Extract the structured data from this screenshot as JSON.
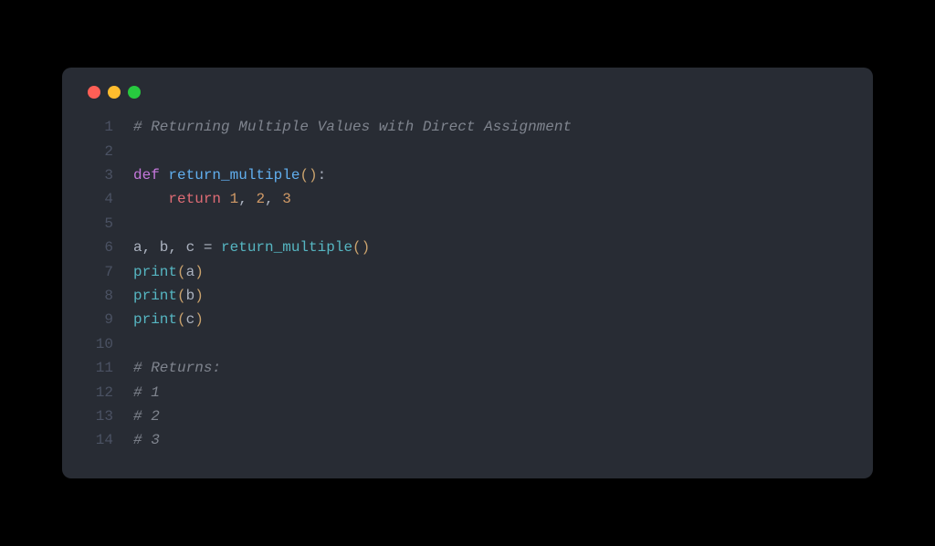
{
  "window": {
    "traffic_lights": [
      "red",
      "yellow",
      "green"
    ]
  },
  "code": {
    "lines": [
      {
        "n": "1",
        "tokens": [
          {
            "cls": "tok-comment",
            "t": "# Returning Multiple Values with Direct Assignment"
          }
        ]
      },
      {
        "n": "2",
        "tokens": []
      },
      {
        "n": "3",
        "tokens": [
          {
            "cls": "tok-def",
            "t": "def "
          },
          {
            "cls": "tok-funcname",
            "t": "return_multiple"
          },
          {
            "cls": "tok-paren",
            "t": "()"
          },
          {
            "cls": "tok-punct",
            "t": ":"
          }
        ]
      },
      {
        "n": "4",
        "tokens": [
          {
            "cls": "tok-ident",
            "t": "    "
          },
          {
            "cls": "tok-return",
            "t": "return "
          },
          {
            "cls": "tok-number",
            "t": "1"
          },
          {
            "cls": "tok-punct",
            "t": ", "
          },
          {
            "cls": "tok-number",
            "t": "2"
          },
          {
            "cls": "tok-punct",
            "t": ", "
          },
          {
            "cls": "tok-number",
            "t": "3"
          }
        ]
      },
      {
        "n": "5",
        "tokens": []
      },
      {
        "n": "6",
        "tokens": [
          {
            "cls": "tok-ident",
            "t": "a, b, c "
          },
          {
            "cls": "tok-punct",
            "t": "= "
          },
          {
            "cls": "tok-call",
            "t": "return_multiple"
          },
          {
            "cls": "tok-paren",
            "t": "()"
          }
        ]
      },
      {
        "n": "7",
        "tokens": [
          {
            "cls": "tok-builtin",
            "t": "print"
          },
          {
            "cls": "tok-paren",
            "t": "("
          },
          {
            "cls": "tok-ident",
            "t": "a"
          },
          {
            "cls": "tok-paren",
            "t": ")"
          }
        ]
      },
      {
        "n": "8",
        "tokens": [
          {
            "cls": "tok-builtin",
            "t": "print"
          },
          {
            "cls": "tok-paren",
            "t": "("
          },
          {
            "cls": "tok-ident",
            "t": "b"
          },
          {
            "cls": "tok-paren",
            "t": ")"
          }
        ]
      },
      {
        "n": "9",
        "tokens": [
          {
            "cls": "tok-builtin",
            "t": "print"
          },
          {
            "cls": "tok-paren",
            "t": "("
          },
          {
            "cls": "tok-ident",
            "t": "c"
          },
          {
            "cls": "tok-paren",
            "t": ")"
          }
        ]
      },
      {
        "n": "10",
        "tokens": []
      },
      {
        "n": "11",
        "tokens": [
          {
            "cls": "tok-comment",
            "t": "# Returns:"
          }
        ]
      },
      {
        "n": "12",
        "tokens": [
          {
            "cls": "tok-comment",
            "t": "# 1"
          }
        ]
      },
      {
        "n": "13",
        "tokens": [
          {
            "cls": "tok-comment",
            "t": "# 2"
          }
        ]
      },
      {
        "n": "14",
        "tokens": [
          {
            "cls": "tok-comment",
            "t": "# 3"
          }
        ]
      }
    ]
  }
}
